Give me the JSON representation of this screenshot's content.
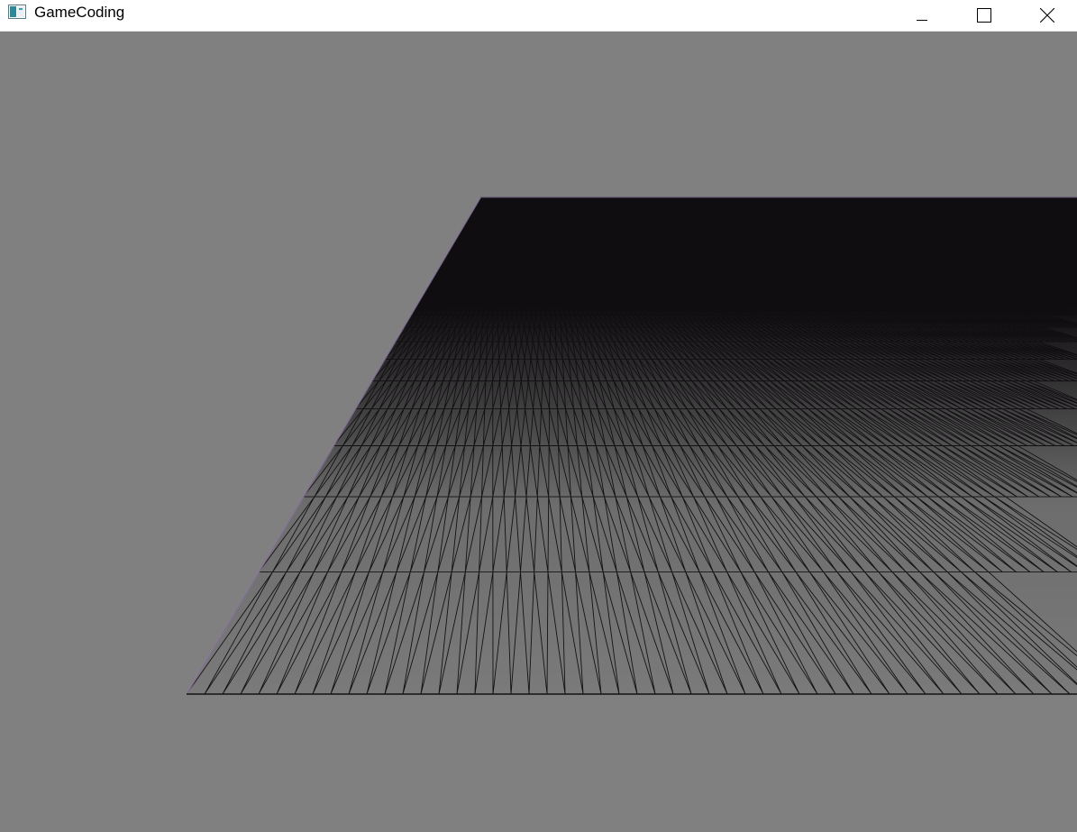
{
  "window": {
    "title": "GameCoding",
    "icon": "app-window-icon",
    "controls": {
      "minimize_icon": "minimize-icon",
      "maximize_icon": "maximize-icon",
      "close_icon": "close-icon"
    }
  },
  "scene": {
    "clear_color": "#808080",
    "terrain_fill": "#0f0d0f",
    "wire_color": "#141214",
    "edge_highlight": "#7a6a8a",
    "render_mode": "wireframe"
  }
}
